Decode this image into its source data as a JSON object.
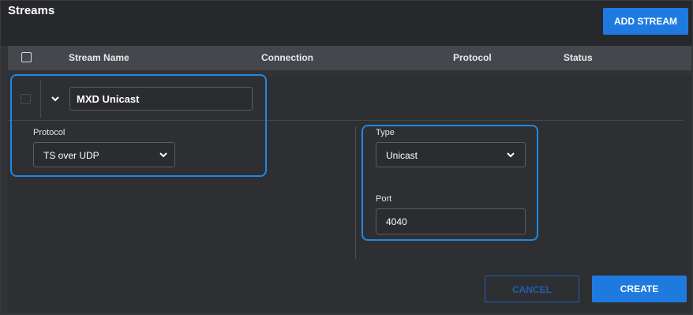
{
  "page": {
    "title": "Streams",
    "add_button": "ADD STREAM"
  },
  "table": {
    "headers": [
      "Stream Name",
      "Connection",
      "Protocol",
      "Status"
    ]
  },
  "stream": {
    "name": "MXD Unicast"
  },
  "protocol": {
    "label": "Protocol",
    "value": "TS over UDP"
  },
  "type": {
    "label": "Type",
    "value": "Unicast"
  },
  "port": {
    "label": "Port",
    "value": "4040"
  },
  "actions": {
    "cancel": "CANCEL",
    "create": "CREATE"
  },
  "icons": {
    "expand": "chevron-down-icon",
    "dropdown": "chevron-down-icon"
  },
  "colors": {
    "accent": "#1f7ae0",
    "highlight": "#1e88e5",
    "background": "#323337"
  }
}
